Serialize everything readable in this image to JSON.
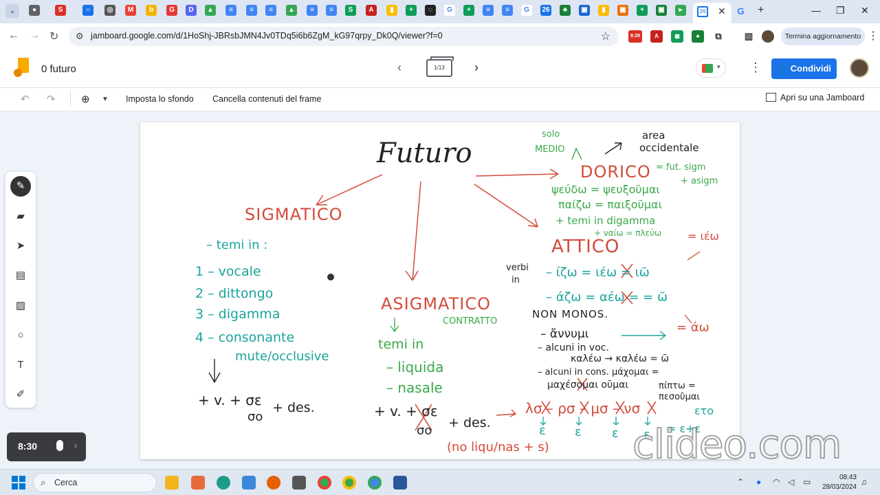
{
  "browser": {
    "url": "jamboard.google.com/d/1HoShj-JBRsbJMN4Jv0TDq5i6b6ZgM_kG97qrpy_Dk0Q/viewer?f=0",
    "update_button": "Termina aggiornamento",
    "active_tab_close": "✕",
    "ext_badge": "8:29"
  },
  "app": {
    "doc_title": "0 futuro",
    "frame_indicator": "1/13",
    "share_label": "Condividi",
    "brand_color": "#f9ab00",
    "accent_color": "#1a73e8"
  },
  "toolbar": {
    "set_background": "Imposta lo sfondo",
    "clear_frame": "Cancella contenuti del frame",
    "open_jamboard": "Apri su una Jamboard"
  },
  "board": {
    "title": "Futuro",
    "sigmatico": {
      "heading": "SIGMATICO",
      "sub": "– temi in :",
      "items": [
        "1 – vocale",
        "2 – dittongo",
        "3 – digamma",
        "4 – consonante",
        "mute/occlusive"
      ],
      "formula": "+ v. + σε",
      "formula_sub": "σο",
      "formula_tail": "+ des."
    },
    "asigmatico": {
      "heading": "ASIGMATICO",
      "contratto": "CONTRATTO",
      "sub": "temi in",
      "items": [
        "– liquida",
        "– nasale"
      ],
      "formula": "+ v. + σε",
      "formula_sub": "σο",
      "formula_tail": "+ des.",
      "note": "(no liqu/nas + s)"
    },
    "right": {
      "solo": "solo",
      "medio": "MEDIO",
      "area_1": "area",
      "area_2": "occidentale",
      "dorico": "DORICO",
      "dorico_note_1": "= fut. sigm",
      "dorico_note_2": "+ asigm",
      "dorico_ex_1": "ψεύδω = ψευξοῦμαι",
      "dorico_ex_2": "παίζω = παιξοῦμαι",
      "dorico_ex_3": "+ temi in digamma",
      "dorico_ex_4": "+ ναίω = πλεύω",
      "attico": "ATTICO",
      "attico_eq": "= ιέω",
      "verbi": "verbi",
      "verbi_in": "in",
      "line_1": "– ίζω = ιέω = ιῶ",
      "line_2": "– άζω = αέω = = ῶ",
      "non_monos": "NON MONOS.",
      "line_3": "– ἄννυμι",
      "line_3_eq": "= άω",
      "line_4": "– alcuni in voc.",
      "line_5": "καλέω → καλέω = ῶ",
      "line_6": "– alcuni in cons. μάχομαι =",
      "line_7": "μαχέσομαι οῦμαι",
      "line_8": "πίπτω =",
      "line_9": "πεσοῦμαι",
      "bottom_seq": "λσ – ρσ – μσ – νσ",
      "bottom_e": "ε",
      "bottom_eto": "ετο",
      "bottom_eq": "= ε+ε"
    }
  },
  "recorder": {
    "time": "8:30"
  },
  "watermark": "clideo.com",
  "taskbar": {
    "search": "Cerca",
    "time": "08:43",
    "date": "28/03/2024"
  }
}
